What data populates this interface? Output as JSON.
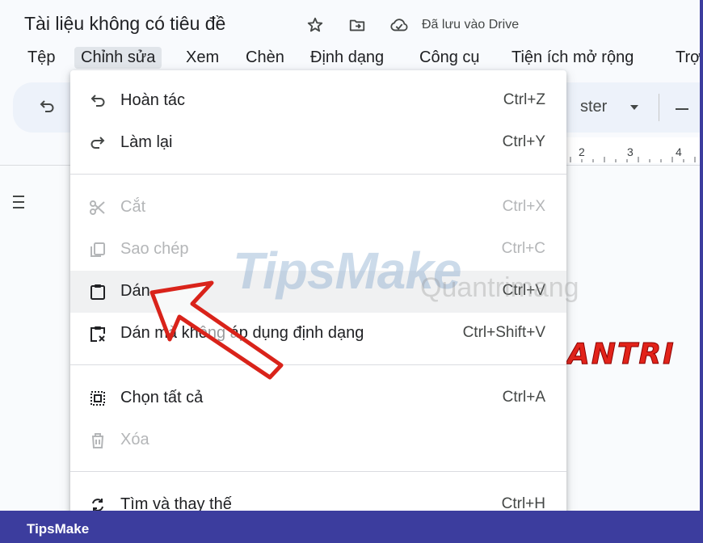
{
  "doc": {
    "title": "Tài liệu không có tiêu đề",
    "saved_status": "Đã lưu vào Drive",
    "icons": [
      "star-icon",
      "move-folder-icon",
      "cloud-saved-icon"
    ]
  },
  "menubar": {
    "items": [
      "Tệp",
      "Chỉnh sửa",
      "Xem",
      "Chèn",
      "Định dạng",
      "Công cụ",
      "Tiện ích mở rộng",
      "Trợ"
    ],
    "active": "Chỉnh sửa"
  },
  "toolbar": {
    "font_partial": "ster"
  },
  "ruler": {
    "numbers": [
      "2",
      "3",
      "4"
    ]
  },
  "edit_menu": {
    "items": [
      {
        "label": "Hoàn tác",
        "shortcut": "Ctrl+Z",
        "icon": "undo-icon",
        "enabled": true
      },
      {
        "label": "Làm lại",
        "shortcut": "Ctrl+Y",
        "icon": "redo-icon",
        "enabled": true
      },
      {
        "label": "Cắt",
        "shortcut": "Ctrl+X",
        "icon": "scissors-icon",
        "enabled": false
      },
      {
        "label": "Sao chép",
        "shortcut": "Ctrl+C",
        "icon": "copy-icon",
        "enabled": false
      },
      {
        "label": "Dán",
        "shortcut": "Ctrl+V",
        "icon": "clipboard-icon",
        "enabled": true,
        "highlighted": true
      },
      {
        "label": "Dán mà không áp dụng định dạng",
        "shortcut": "Ctrl+Shift+V",
        "icon": "paste-plain-icon",
        "enabled": true
      },
      {
        "label": "Chọn tất cả",
        "shortcut": "Ctrl+A",
        "icon": "select-all-icon",
        "enabled": true
      },
      {
        "label": "Xóa",
        "shortcut": "",
        "icon": "trash-icon",
        "enabled": false
      },
      {
        "label": "Tìm và thay thế",
        "shortcut": "Ctrl+H",
        "icon": "find-replace-icon",
        "enabled": true
      }
    ]
  },
  "document_body": {
    "red_text": "ANTRI"
  },
  "watermark": {
    "brand": "TipsMake",
    "sub": "Quantrimang"
  },
  "footer": {
    "brand": "TipsMake"
  },
  "colors": {
    "footer_bg": "#3c3d9e",
    "red_text": "#e2231a",
    "arrow": "#d9231a",
    "menu_highlight": "#f0f1f2"
  }
}
